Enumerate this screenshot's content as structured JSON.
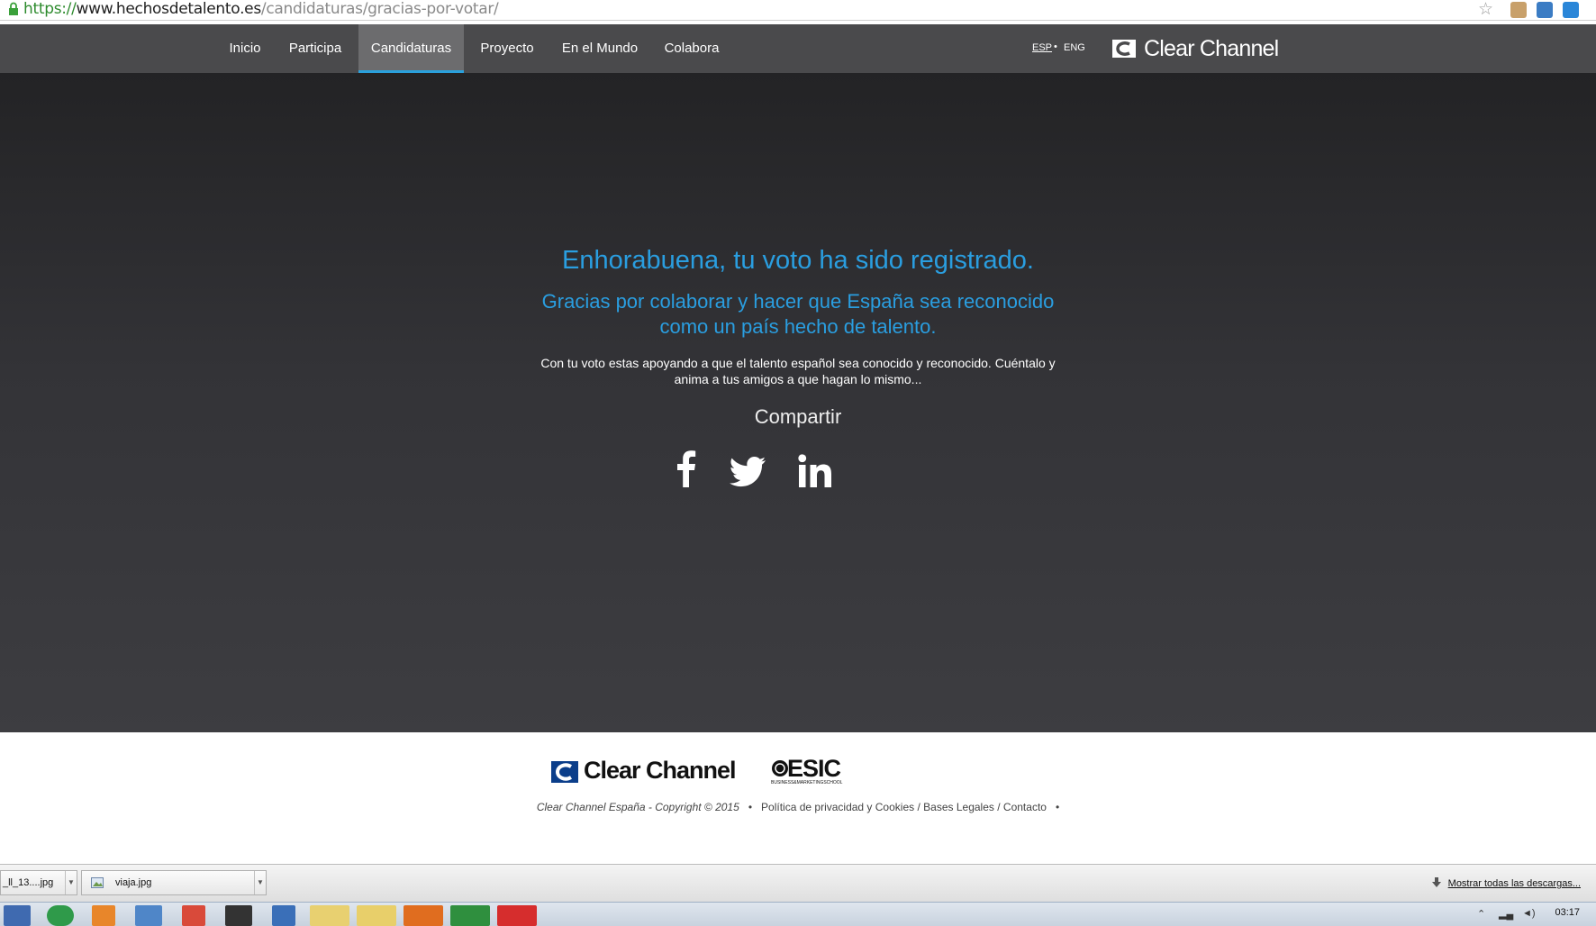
{
  "browser": {
    "url_scheme": "https://",
    "url_host": "www.hechosdetalento.es",
    "url_path": "/candidaturas/gracias-por-votar/"
  },
  "nav": {
    "items": [
      "Inicio",
      "Participa",
      "Candidaturas",
      "Proyecto",
      "En el Mundo",
      "Colabora"
    ],
    "active": "Candidaturas",
    "lang_esp": "ESP",
    "lang_sep": "•",
    "lang_eng": "ENG",
    "brand": "Clear Channel"
  },
  "hero": {
    "title": "Enhorabuena, tu voto ha sido registrado.",
    "subtitle_line1": "Gracias por colaborar y hacer que España sea reconocido",
    "subtitle_line2": "como un país hecho de talento.",
    "body_line1": "Con tu voto estas apoyando a que el talento español sea conocido y reconocido. Cuéntalo y",
    "body_line2": "anima a tus amigos a que hagan lo mismo...",
    "share_label": "Compartir",
    "social": [
      "facebook-icon",
      "twitter-icon",
      "linkedin-icon"
    ]
  },
  "footer": {
    "brand_cc": "Clear Channel",
    "brand_esic": "ESIC",
    "brand_esic_sub": "BUSINESS&MARKETINGSCHOOL",
    "copyright": "Clear Channel España - Copyright © 2015",
    "bullet": "•",
    "privacy": "Política de privacidad y Cookies",
    "sep": "/",
    "legal": "Bases Legales",
    "contact": "Contacto"
  },
  "downloads": {
    "item1": "_ll_13....jpg",
    "item2": "viaja.jpg",
    "show_all": "Mostrar todas las descargas..."
  },
  "taskbar": {
    "clock": "03:17"
  },
  "colors": {
    "accent_blue": "#2a9ee0",
    "nav_bg": "#4a4a4c",
    "hero_bg": "#333337"
  }
}
